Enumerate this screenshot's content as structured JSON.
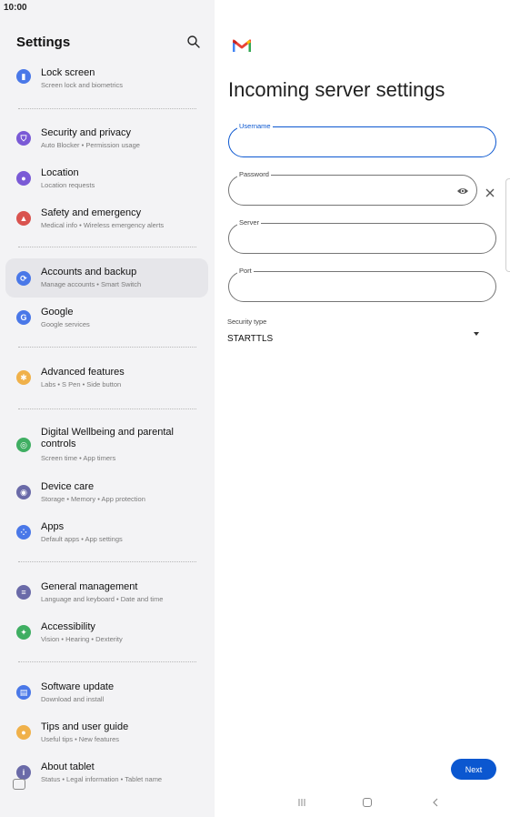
{
  "status_bar": {
    "time": "10:00"
  },
  "settings": {
    "title": "Settings",
    "items": [
      {
        "title": "Lock screen",
        "subtitle": "Screen lock and biometrics",
        "color": "#4a78e8",
        "glyph": "🔒"
      },
      {
        "title": "Security and privacy",
        "subtitle": "Auto Blocker  •  Permission usage",
        "color": "#7a5ad6",
        "glyph": "⛉"
      },
      {
        "title": "Location",
        "subtitle": "Location requests",
        "color": "#7a5ad6",
        "glyph": "●"
      },
      {
        "title": "Safety and emergency",
        "subtitle": "Medical info  •  Wireless emergency alerts",
        "color": "#d9534f",
        "glyph": "▲"
      },
      {
        "title": "Accounts and backup",
        "subtitle": "Manage accounts  •  Smart Switch",
        "color": "#4a78e8",
        "glyph": "⟳"
      },
      {
        "title": "Google",
        "subtitle": "Google services",
        "color": "#4a78e8",
        "glyph": "G"
      },
      {
        "title": "Advanced features",
        "subtitle": "Labs  •  S Pen  •  Side button",
        "color": "#f0b14a",
        "glyph": "✱"
      },
      {
        "title": "Digital Wellbeing and parental controls",
        "subtitle": "Screen time  •  App timers",
        "color": "#3fae62",
        "glyph": "◎"
      },
      {
        "title": "Device care",
        "subtitle": "Storage  •  Memory  •  App protection",
        "color": "#6a6aa8",
        "glyph": "◉"
      },
      {
        "title": "Apps",
        "subtitle": "Default apps  •  App settings",
        "color": "#4a78e8",
        "glyph": "⁘"
      },
      {
        "title": "General management",
        "subtitle": "Language and keyboard  •  Date and time",
        "color": "#6a6aa8",
        "glyph": "≡"
      },
      {
        "title": "Accessibility",
        "subtitle": "Vision  •  Hearing  •  Dexterity",
        "color": "#3fae62",
        "glyph": "✦"
      },
      {
        "title": "Software update",
        "subtitle": "Download and install",
        "color": "#4a78e8",
        "glyph": "▤"
      },
      {
        "title": "Tips and user guide",
        "subtitle": "Useful tips  •  New features",
        "color": "#f0b14a",
        "glyph": "●"
      },
      {
        "title": "About tablet",
        "subtitle": "Status  •  Legal information  •  Tablet name",
        "color": "#6a6aa8",
        "glyph": "i"
      }
    ]
  },
  "form": {
    "title": "Incoming server settings",
    "username_label": "Username",
    "password_label": "Password",
    "server_label": "Server",
    "port_label": "Port",
    "security_label": "Security type",
    "security_value": "STARTTLS",
    "next_label": "Next"
  },
  "colors": {
    "accent": "#0b57d0",
    "panel_bg": "#f3f3f5",
    "active_item_bg": "#e6e6ea"
  }
}
